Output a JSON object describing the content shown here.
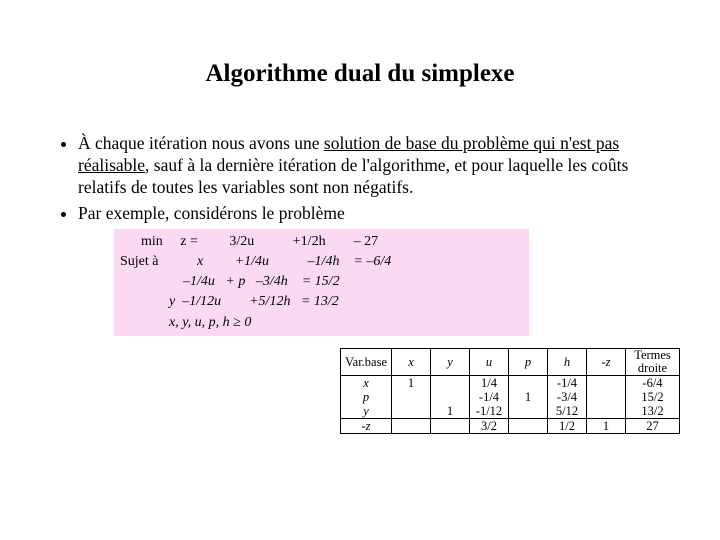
{
  "title": "Algorithme dual du simplexe",
  "bullet1_a": "À chaque itération nous avons une ",
  "bullet1_b": "solution de base du problème qui n'est pas réalisable",
  "bullet1_c": ", sauf à la dernière itération de l'algorithme, et pour laquelle les coûts relatifs de toutes les variables sont non négatifs.",
  "bullet2": "Par exemple, considérons le problème",
  "math": {
    "r1": "      min     z =         3/2u           +1/2h        – 27",
    "r2_l": "Sujet à",
    "r2_r": "           x         +1/4u           –1/4h    = –6/4",
    "r3": "                  –1/4u   + p   –3/4h    = 15/2",
    "r4": "              y  –1/12u        +5/12h   = 13/2",
    "r5": "              x, y, u, p, h ≥ 0"
  },
  "table": {
    "head": [
      "Var.base",
      "x",
      "y",
      "u",
      "p",
      "h",
      "-z",
      "Termes droite"
    ],
    "rows": [
      {
        "lab": "x",
        "c": [
          "1",
          "",
          "1/4",
          "",
          "-1/4",
          "",
          "-6/4"
        ]
      },
      {
        "lab": "p",
        "c": [
          "",
          "",
          "-1/4",
          "1",
          "-3/4",
          "",
          "15/2"
        ]
      },
      {
        "lab": "y",
        "c": [
          "",
          "1",
          "-1/12",
          "",
          "5/12",
          "",
          "13/2"
        ]
      },
      {
        "lab": "-z",
        "c": [
          "",
          "",
          "3/2",
          "",
          "1/2",
          "1",
          "27"
        ]
      }
    ]
  }
}
